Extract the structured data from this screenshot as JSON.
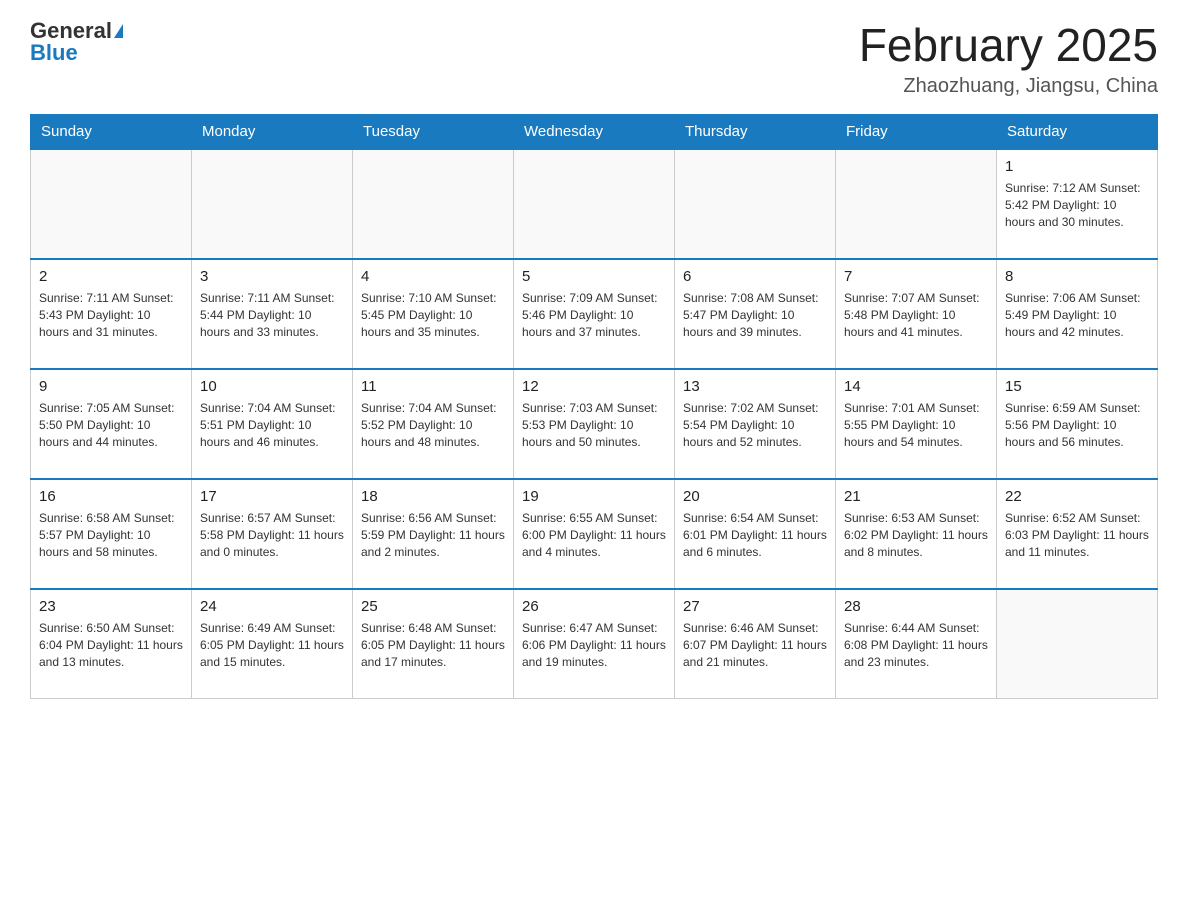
{
  "header": {
    "logo_general": "General",
    "logo_blue": "Blue",
    "month_title": "February 2025",
    "location": "Zhaozhuang, Jiangsu, China"
  },
  "weekdays": [
    "Sunday",
    "Monday",
    "Tuesday",
    "Wednesday",
    "Thursday",
    "Friday",
    "Saturday"
  ],
  "weeks": [
    [
      {
        "day": "",
        "info": ""
      },
      {
        "day": "",
        "info": ""
      },
      {
        "day": "",
        "info": ""
      },
      {
        "day": "",
        "info": ""
      },
      {
        "day": "",
        "info": ""
      },
      {
        "day": "",
        "info": ""
      },
      {
        "day": "1",
        "info": "Sunrise: 7:12 AM\nSunset: 5:42 PM\nDaylight: 10 hours and 30 minutes."
      }
    ],
    [
      {
        "day": "2",
        "info": "Sunrise: 7:11 AM\nSunset: 5:43 PM\nDaylight: 10 hours and 31 minutes."
      },
      {
        "day": "3",
        "info": "Sunrise: 7:11 AM\nSunset: 5:44 PM\nDaylight: 10 hours and 33 minutes."
      },
      {
        "day": "4",
        "info": "Sunrise: 7:10 AM\nSunset: 5:45 PM\nDaylight: 10 hours and 35 minutes."
      },
      {
        "day": "5",
        "info": "Sunrise: 7:09 AM\nSunset: 5:46 PM\nDaylight: 10 hours and 37 minutes."
      },
      {
        "day": "6",
        "info": "Sunrise: 7:08 AM\nSunset: 5:47 PM\nDaylight: 10 hours and 39 minutes."
      },
      {
        "day": "7",
        "info": "Sunrise: 7:07 AM\nSunset: 5:48 PM\nDaylight: 10 hours and 41 minutes."
      },
      {
        "day": "8",
        "info": "Sunrise: 7:06 AM\nSunset: 5:49 PM\nDaylight: 10 hours and 42 minutes."
      }
    ],
    [
      {
        "day": "9",
        "info": "Sunrise: 7:05 AM\nSunset: 5:50 PM\nDaylight: 10 hours and 44 minutes."
      },
      {
        "day": "10",
        "info": "Sunrise: 7:04 AM\nSunset: 5:51 PM\nDaylight: 10 hours and 46 minutes."
      },
      {
        "day": "11",
        "info": "Sunrise: 7:04 AM\nSunset: 5:52 PM\nDaylight: 10 hours and 48 minutes."
      },
      {
        "day": "12",
        "info": "Sunrise: 7:03 AM\nSunset: 5:53 PM\nDaylight: 10 hours and 50 minutes."
      },
      {
        "day": "13",
        "info": "Sunrise: 7:02 AM\nSunset: 5:54 PM\nDaylight: 10 hours and 52 minutes."
      },
      {
        "day": "14",
        "info": "Sunrise: 7:01 AM\nSunset: 5:55 PM\nDaylight: 10 hours and 54 minutes."
      },
      {
        "day": "15",
        "info": "Sunrise: 6:59 AM\nSunset: 5:56 PM\nDaylight: 10 hours and 56 minutes."
      }
    ],
    [
      {
        "day": "16",
        "info": "Sunrise: 6:58 AM\nSunset: 5:57 PM\nDaylight: 10 hours and 58 minutes."
      },
      {
        "day": "17",
        "info": "Sunrise: 6:57 AM\nSunset: 5:58 PM\nDaylight: 11 hours and 0 minutes."
      },
      {
        "day": "18",
        "info": "Sunrise: 6:56 AM\nSunset: 5:59 PM\nDaylight: 11 hours and 2 minutes."
      },
      {
        "day": "19",
        "info": "Sunrise: 6:55 AM\nSunset: 6:00 PM\nDaylight: 11 hours and 4 minutes."
      },
      {
        "day": "20",
        "info": "Sunrise: 6:54 AM\nSunset: 6:01 PM\nDaylight: 11 hours and 6 minutes."
      },
      {
        "day": "21",
        "info": "Sunrise: 6:53 AM\nSunset: 6:02 PM\nDaylight: 11 hours and 8 minutes."
      },
      {
        "day": "22",
        "info": "Sunrise: 6:52 AM\nSunset: 6:03 PM\nDaylight: 11 hours and 11 minutes."
      }
    ],
    [
      {
        "day": "23",
        "info": "Sunrise: 6:50 AM\nSunset: 6:04 PM\nDaylight: 11 hours and 13 minutes."
      },
      {
        "day": "24",
        "info": "Sunrise: 6:49 AM\nSunset: 6:05 PM\nDaylight: 11 hours and 15 minutes."
      },
      {
        "day": "25",
        "info": "Sunrise: 6:48 AM\nSunset: 6:05 PM\nDaylight: 11 hours and 17 minutes."
      },
      {
        "day": "26",
        "info": "Sunrise: 6:47 AM\nSunset: 6:06 PM\nDaylight: 11 hours and 19 minutes."
      },
      {
        "day": "27",
        "info": "Sunrise: 6:46 AM\nSunset: 6:07 PM\nDaylight: 11 hours and 21 minutes."
      },
      {
        "day": "28",
        "info": "Sunrise: 6:44 AM\nSunset: 6:08 PM\nDaylight: 11 hours and 23 minutes."
      },
      {
        "day": "",
        "info": ""
      }
    ]
  ]
}
